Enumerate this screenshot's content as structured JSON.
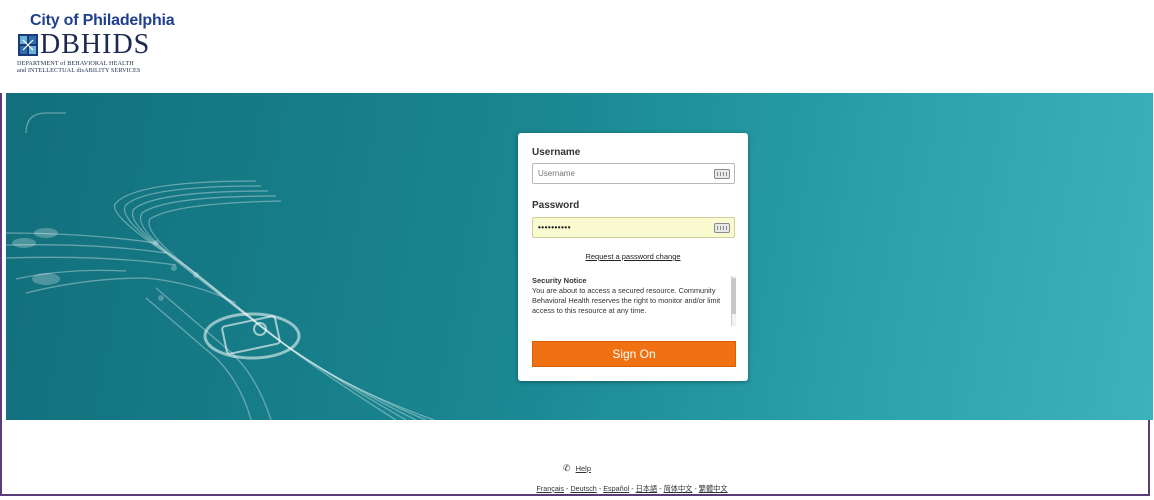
{
  "brand": {
    "city": "City of Philadelphia",
    "name": "DBHIDS",
    "subline1": "DEPARTMENT of BEHAVIORAL HEALTH",
    "subline2": "and INTELLECTUAL disABILITY SERVICES"
  },
  "colors": {
    "accent": "#f07111",
    "hero_dark": "#126f7c",
    "hero_light": "#3db2bd",
    "frame": "#5b3c7a"
  },
  "login": {
    "username_label": "Username",
    "username_placeholder": "Username",
    "username_value": "",
    "password_label": "Password",
    "password_value": "••••••••••",
    "reset_link": "Request a password change",
    "notice_title": "Security Notice",
    "notice_body": "You are about to access a secured resource. Community Behavioral Health reserves the right to monitor and/or limit access to this resource at any time.",
    "submit_label": "Sign On",
    "keyboard_icon": "keyboard-icon"
  },
  "footer": {
    "help_icon": "phone-icon",
    "help_label": "Help",
    "languages": [
      "Français",
      "Deutsch",
      "Español",
      "日本語",
      "简体中文",
      "繁體中文"
    ]
  }
}
